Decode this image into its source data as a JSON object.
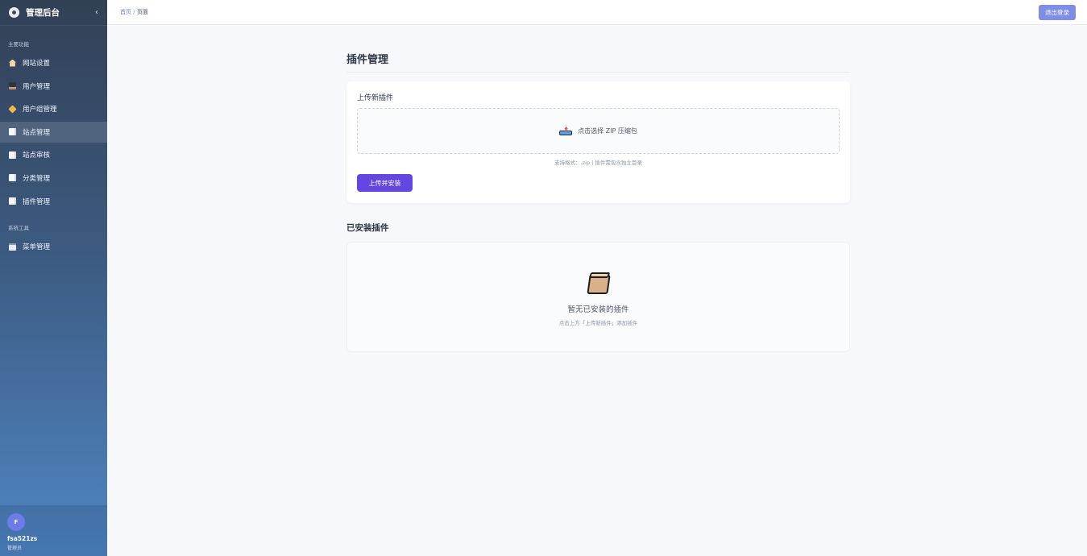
{
  "sidebar": {
    "title": "管理后台",
    "collapse_icon": "‹",
    "section_main": "主要功能",
    "items_main": [
      {
        "label": "网站设置",
        "icon": "home-icon"
      },
      {
        "label": "用户管理",
        "icon": "user-icon"
      },
      {
        "label": "用户组管理",
        "icon": "tag-icon"
      },
      {
        "label": "站点管理",
        "icon": "document-icon",
        "active": true
      },
      {
        "label": "站点审核",
        "icon": "document-icon"
      },
      {
        "label": "分类管理",
        "icon": "document-icon"
      },
      {
        "label": "插件管理",
        "icon": "document-icon"
      }
    ],
    "section_tools": "系统工具",
    "items_tools": [
      {
        "label": "菜单管理",
        "icon": "clipboard-icon"
      }
    ],
    "user": {
      "avatar_letter": "F",
      "name": "fsa521zs",
      "role": "管理员"
    }
  },
  "topbar": {
    "breadcrumb_home": "首页",
    "breadcrumb_sep": "/",
    "breadcrumb_current": "页面",
    "logout_label": "退出登录"
  },
  "main": {
    "title": "插件管理",
    "upload": {
      "title": "上传新插件",
      "dropzone_text": "点击选择 ZIP 压缩包",
      "hint": "支持格式：.zip | 插件需包含独立目录",
      "button": "上传并安装"
    },
    "installed": {
      "title": "已安装插件",
      "empty_title": "暂无已安装的插件",
      "empty_sub": "点击上方「上传新插件」添加插件"
    }
  },
  "colors": {
    "accent": "#6446e0",
    "logout": "#7f8de6",
    "link": "#6b7fe6"
  }
}
